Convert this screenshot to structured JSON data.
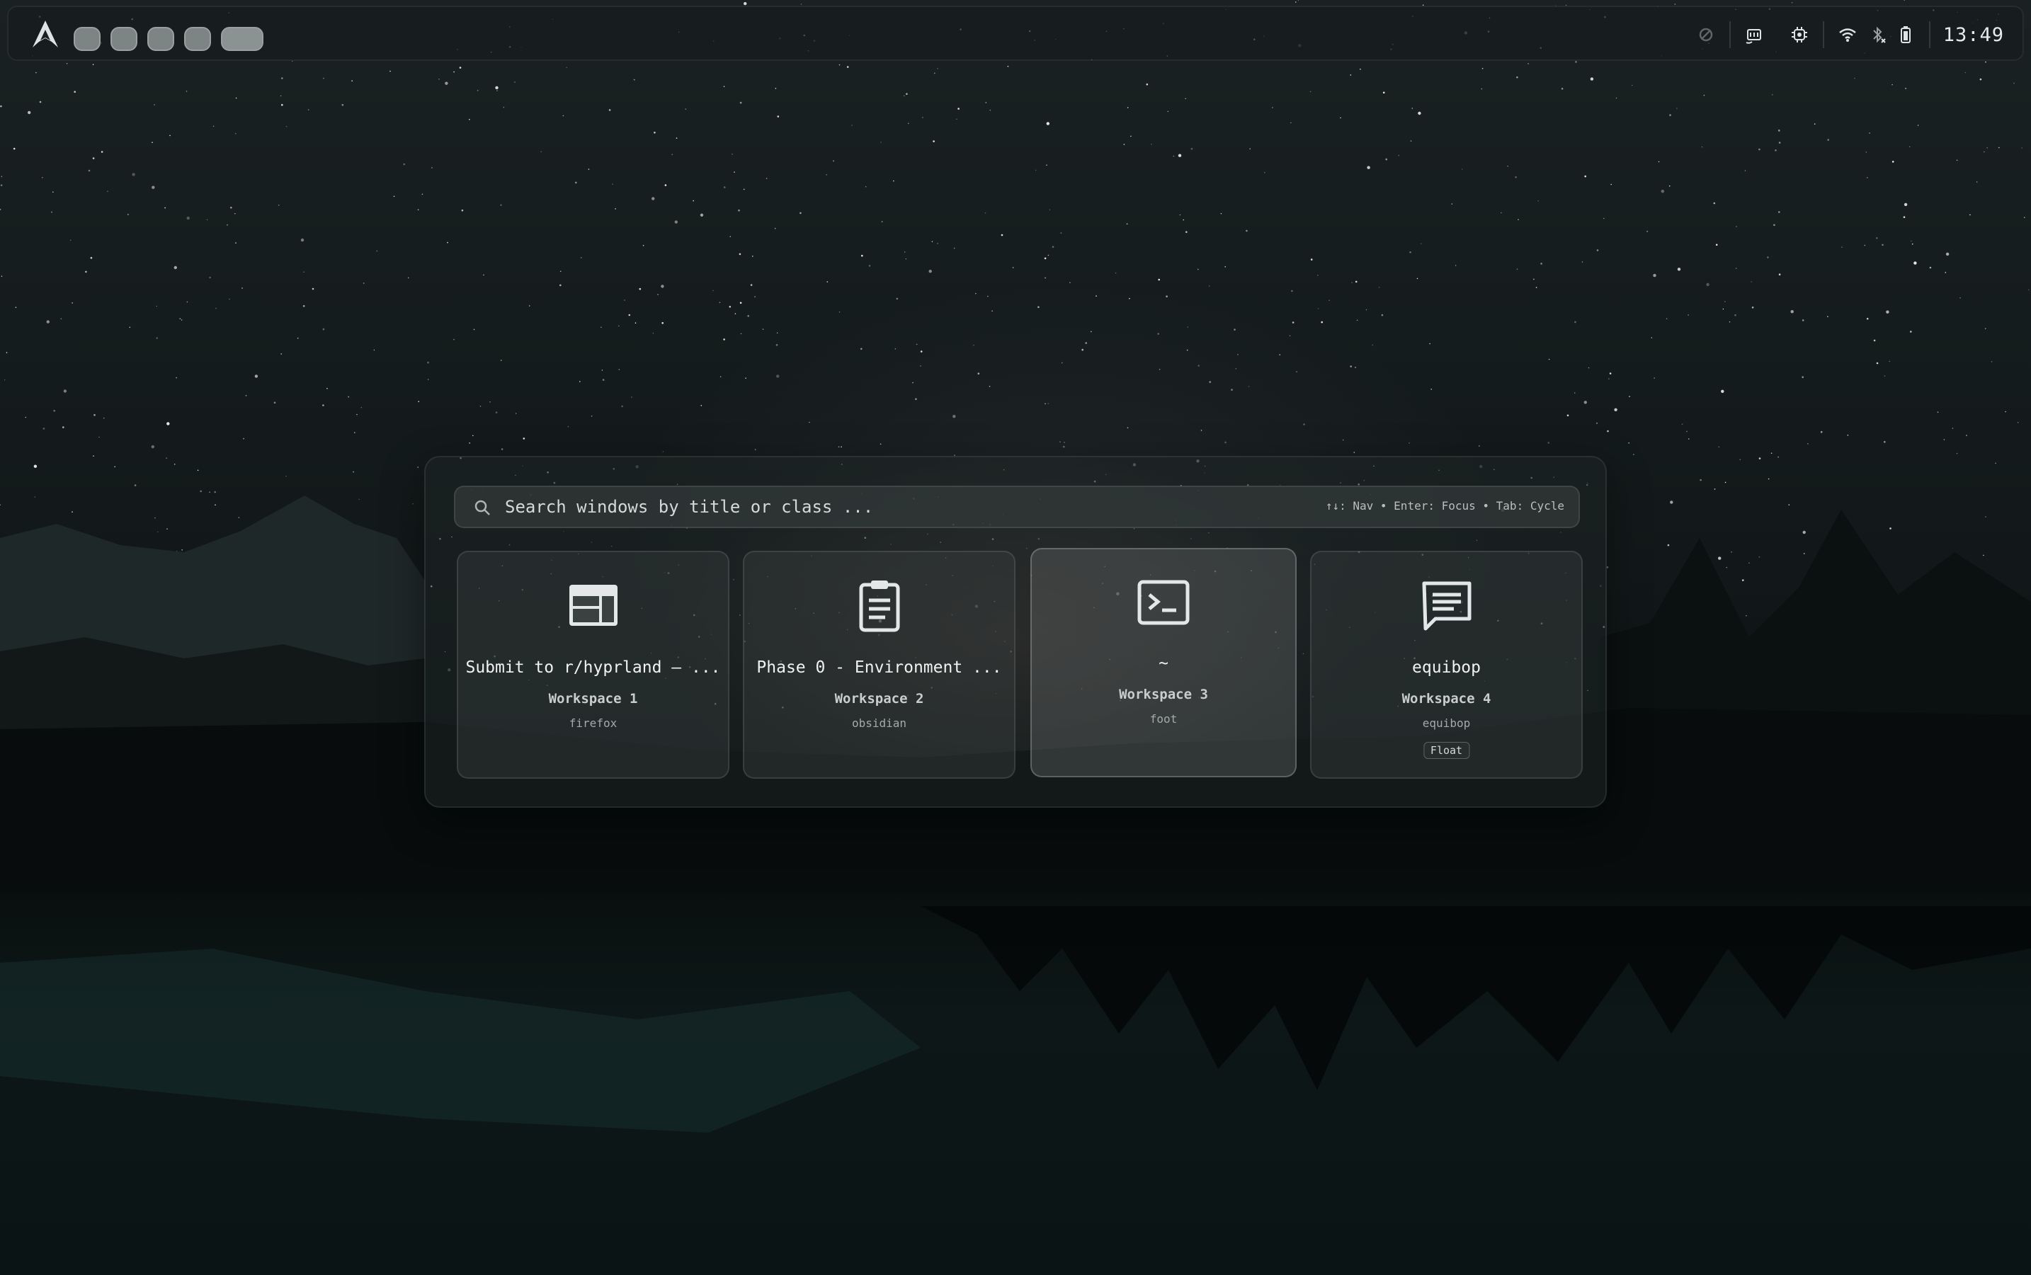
{
  "topbar": {
    "workspace_count": 5,
    "active_workspace": 5,
    "clock": "13:49"
  },
  "search": {
    "placeholder": "Search windows by title or class ...",
    "hints": "↑↓: Nav • Enter: Focus • Tab: Cycle"
  },
  "windows": [
    {
      "title": "Submit to r/hyprland — ...",
      "workspace": "Workspace 1",
      "class": "firefox",
      "icon": "browser-window-icon",
      "selected": false,
      "badge": ""
    },
    {
      "title": "Phase 0 - Environment  ...",
      "workspace": "Workspace 2",
      "class": "obsidian",
      "icon": "clipboard-note-icon",
      "selected": false,
      "badge": ""
    },
    {
      "title": "~",
      "workspace": "Workspace 3",
      "class": "foot",
      "icon": "terminal-icon",
      "selected": true,
      "badge": ""
    },
    {
      "title": "equibop",
      "workspace": "Workspace 4",
      "class": "equibop",
      "icon": "chat-bubble-icon",
      "selected": false,
      "badge": "Float"
    }
  ],
  "colors": {
    "accent": "#e6e9ea",
    "panel": "#1e2424",
    "workspace_dot": "#7d8484"
  }
}
